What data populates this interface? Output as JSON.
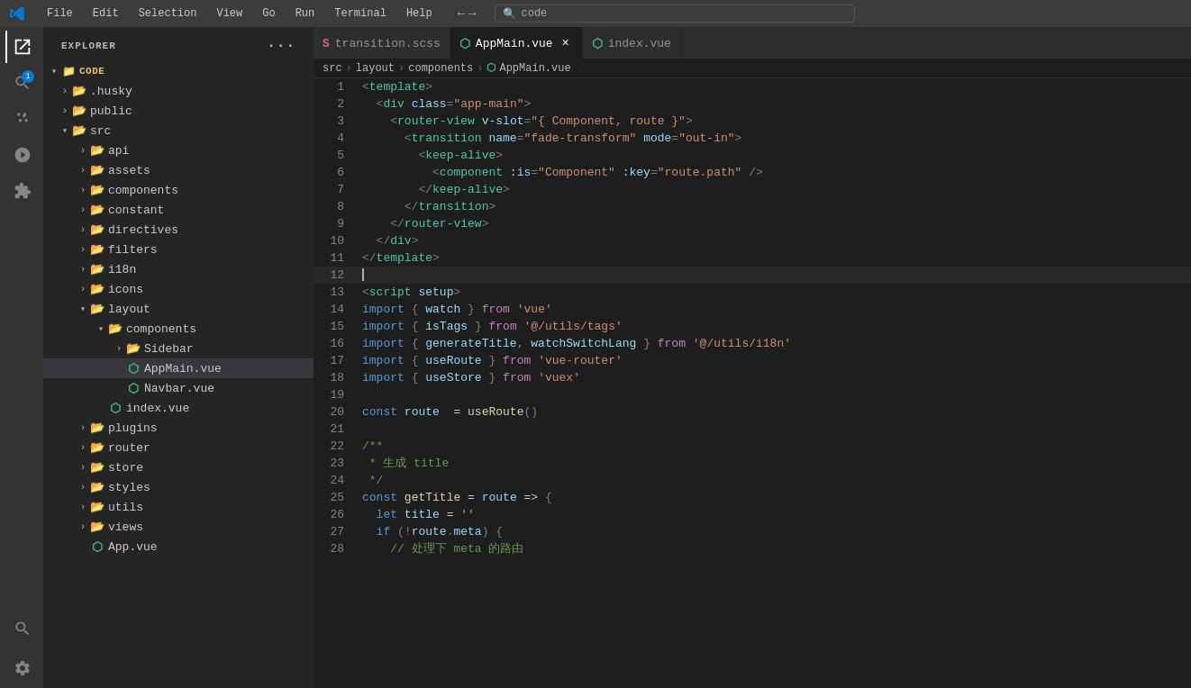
{
  "titlebar": {
    "menu": [
      "File",
      "Edit",
      "Selection",
      "View",
      "Go",
      "Run",
      "Terminal",
      "Help"
    ],
    "search_placeholder": "code",
    "nav_back": "←",
    "nav_forward": "→"
  },
  "sidebar": {
    "header": "EXPLORER",
    "more_icon": "···",
    "root": "CODE",
    "items": [
      {
        "id": "husky",
        "label": ".husky",
        "indent": 1,
        "type": "folder",
        "expanded": false
      },
      {
        "id": "public",
        "label": "public",
        "indent": 1,
        "type": "folder",
        "expanded": false
      },
      {
        "id": "src",
        "label": "src",
        "indent": 1,
        "type": "folder",
        "expanded": true
      },
      {
        "id": "api",
        "label": "api",
        "indent": 2,
        "type": "folder",
        "expanded": false
      },
      {
        "id": "assets",
        "label": "assets",
        "indent": 2,
        "type": "folder",
        "expanded": false
      },
      {
        "id": "components",
        "label": "components",
        "indent": 2,
        "type": "folder",
        "expanded": false
      },
      {
        "id": "constant",
        "label": "constant",
        "indent": 2,
        "type": "folder",
        "expanded": false
      },
      {
        "id": "directives",
        "label": "directives",
        "indent": 2,
        "type": "folder",
        "expanded": false
      },
      {
        "id": "filters",
        "label": "filters",
        "indent": 2,
        "type": "folder",
        "expanded": false
      },
      {
        "id": "i18n",
        "label": "i18n",
        "indent": 2,
        "type": "folder",
        "expanded": false
      },
      {
        "id": "icons",
        "label": "icons",
        "indent": 2,
        "type": "folder",
        "expanded": false
      },
      {
        "id": "layout",
        "label": "layout",
        "indent": 2,
        "type": "folder",
        "expanded": true
      },
      {
        "id": "layout-components",
        "label": "components",
        "indent": 3,
        "type": "folder",
        "expanded": true
      },
      {
        "id": "sidebar",
        "label": "Sidebar",
        "indent": 4,
        "type": "folder",
        "expanded": false
      },
      {
        "id": "appmain",
        "label": "AppMain.vue",
        "indent": 4,
        "type": "vue",
        "selected": true
      },
      {
        "id": "navbar",
        "label": "Navbar.vue",
        "indent": 4,
        "type": "vue"
      },
      {
        "id": "index-vue",
        "label": "index.vue",
        "indent": 3,
        "type": "vue"
      },
      {
        "id": "plugins",
        "label": "plugins",
        "indent": 2,
        "type": "folder",
        "expanded": false
      },
      {
        "id": "router",
        "label": "router",
        "indent": 2,
        "type": "folder",
        "expanded": false
      },
      {
        "id": "store",
        "label": "store",
        "indent": 2,
        "type": "folder",
        "expanded": false
      },
      {
        "id": "styles",
        "label": "styles",
        "indent": 2,
        "type": "folder",
        "expanded": false
      },
      {
        "id": "utils",
        "label": "utils",
        "indent": 2,
        "type": "folder",
        "expanded": false
      },
      {
        "id": "views",
        "label": "views",
        "indent": 2,
        "type": "folder",
        "expanded": false
      },
      {
        "id": "app-vue",
        "label": "App.vue",
        "indent": 2,
        "type": "vue"
      }
    ]
  },
  "tabs": [
    {
      "id": "transition",
      "label": "transition.scss",
      "type": "scss",
      "active": false,
      "dirty": false
    },
    {
      "id": "appmain",
      "label": "AppMain.vue",
      "type": "vue",
      "active": true,
      "dirty": false,
      "closeable": true
    },
    {
      "id": "index",
      "label": "index.vue",
      "type": "vue",
      "active": false,
      "dirty": false
    }
  ],
  "breadcrumb": [
    "src",
    "layout",
    "components",
    "AppMain.vue"
  ],
  "code_lines": [
    {
      "n": 1,
      "html": "<span class='c-punct'>&lt;</span><span class='c-tag'>template</span><span class='c-punct'>&gt;</span>"
    },
    {
      "n": 2,
      "html": "  <span class='c-punct'>&lt;</span><span class='c-tag'>div</span> <span class='c-attr'>class</span><span class='c-punct'>=</span><span class='c-str'>\"app-main\"</span><span class='c-punct'>&gt;</span>"
    },
    {
      "n": 3,
      "html": "    <span class='c-punct'>&lt;</span><span class='c-tag'>router-view</span> <span class='c-attr'>v-slot</span><span class='c-punct'>=</span><span class='c-str'>\"{</span> <span class='c-var'>Component</span><span class='c-str'>, route </span><span class='c-str'>}\"</span><span class='c-punct'>&gt;</span>"
    },
    {
      "n": 4,
      "html": "      <span class='c-punct'>&lt;</span><span class='c-tag'>transition</span> <span class='c-attr'>name</span><span class='c-punct'>=</span><span class='c-str'>\"fade-transform\"</span> <span class='c-attr'>mode</span><span class='c-punct'>=</span><span class='c-str'>\"out-in\"</span><span class='c-punct'>&gt;</span>"
    },
    {
      "n": 5,
      "html": "        <span class='c-punct'>&lt;</span><span class='c-tag'>keep-alive</span><span class='c-punct'>&gt;</span>"
    },
    {
      "n": 6,
      "html": "          <span class='c-punct'>&lt;</span><span class='c-tag'>component</span> <span class='c-attr'>:is</span><span class='c-punct'>=</span><span class='c-str'>\"Component\"</span> <span class='c-attr'>:key</span><span class='c-punct'>=</span><span class='c-str'>\"route.path\"</span> <span class='c-punct'>/&gt;</span>"
    },
    {
      "n": 7,
      "html": "        <span class='c-punct'>&lt;/</span><span class='c-tag'>keep-alive</span><span class='c-punct'>&gt;</span>"
    },
    {
      "n": 8,
      "html": "      <span class='c-punct'>&lt;/</span><span class='c-tag'>transition</span><span class='c-punct'>&gt;</span>"
    },
    {
      "n": 9,
      "html": "    <span class='c-punct'>&lt;/</span><span class='c-tag'>router-view</span><span class='c-punct'>&gt;</span>"
    },
    {
      "n": 10,
      "html": "  <span class='c-punct'>&lt;/</span><span class='c-tag'>div</span><span class='c-punct'>&gt;</span>"
    },
    {
      "n": 11,
      "html": "<span class='c-punct'>&lt;/</span><span class='c-tag'>template</span><span class='c-punct'>&gt;</span>"
    },
    {
      "n": 12,
      "html": ""
    },
    {
      "n": 13,
      "html": "<span class='c-punct'>&lt;</span><span class='c-tag'>script</span> <span class='c-attr'>setup</span><span class='c-punct'>&gt;</span>"
    },
    {
      "n": 14,
      "html": "<span class='c-kw'>import</span> <span class='c-punct'>{</span> <span class='c-var'>watch</span> <span class='c-punct'>}</span> <span class='c-import-from'>from</span> <span class='c-str'>'vue'</span>"
    },
    {
      "n": 15,
      "html": "<span class='c-kw'>import</span> <span class='c-punct'>{</span> <span class='c-var'>isTags</span> <span class='c-punct'>}</span> <span class='c-import-from'>from</span> <span class='c-str'>'@/utils/tags'</span>"
    },
    {
      "n": 16,
      "html": "<span class='c-kw'>import</span> <span class='c-punct'>{</span> <span class='c-var'>generateTitle</span><span class='c-punct'>,</span> <span class='c-var'>watchSwitchLang</span> <span class='c-punct'>}</span> <span class='c-import-from'>from</span> <span class='c-str'>'@/utils/i18n'</span>"
    },
    {
      "n": 17,
      "html": "<span class='c-kw'>import</span> <span class='c-punct'>{</span> <span class='c-var'>useRoute</span> <span class='c-punct'>}</span> <span class='c-import-from'>from</span> <span class='c-str'>'vue-router'</span>"
    },
    {
      "n": 18,
      "html": "<span class='c-kw'>import</span> <span class='c-punct'>{</span> <span class='c-var'>useStore</span> <span class='c-punct'>}</span> <span class='c-import-from'>from</span> <span class='c-str'>'vuex'</span>"
    },
    {
      "n": 19,
      "html": ""
    },
    {
      "n": 20,
      "html": "<span class='c-kw'>const</span> <span class='c-var'>route</span> <span class='c-op'>=</span> <span class='c-fn'>useRoute</span><span class='c-punct'>()</span>"
    },
    {
      "n": 21,
      "html": ""
    },
    {
      "n": 22,
      "html": "<span class='c-comment'>/**</span>"
    },
    {
      "n": 23,
      "html": "<span class='c-comment'> * 生成 title</span>"
    },
    {
      "n": 24,
      "html": "<span class='c-comment'> */</span>"
    },
    {
      "n": 25,
      "html": "<span class='c-kw'>const</span> <span class='c-fn'>getTitle</span> <span class='c-op'>=</span> <span class='c-var'>route</span> <span class='c-op'>=&gt;</span> <span class='c-punct'>{</span>"
    },
    {
      "n": 26,
      "html": "  <span class='c-kw'>let</span> <span class='c-var'>title</span> <span class='c-op'>=</span> <span class='c-str'>''</span>"
    },
    {
      "n": 27,
      "html": "  <span class='c-kw'>if</span> <span class='c-punct'>(!</span><span class='c-var'>route</span><span class='c-punct'>.</span><span class='c-var'>meta</span><span class='c-punct'>)</span> <span class='c-punct'>{</span>"
    },
    {
      "n": 28,
      "html": "    <span class='c-comment'>// 处理下 meta 的路由</span>"
    }
  ]
}
